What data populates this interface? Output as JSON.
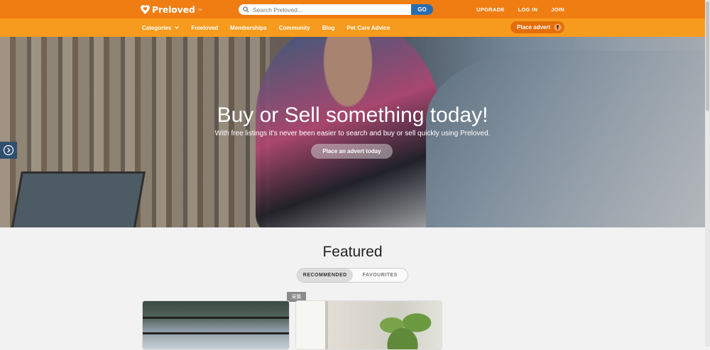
{
  "header": {
    "logo_text": "Preloved",
    "logo_tm": "TM",
    "search_placeholder": "Search Preloved...",
    "go_label": "GO",
    "links": [
      "UPGRADE",
      "LOG IN",
      "JOIN"
    ]
  },
  "nav": {
    "items": [
      "Categories",
      "Freeloved",
      "Memberships",
      "Community",
      "Blog",
      "Pet Care Advice"
    ],
    "place_advert": "Place advert"
  },
  "hero": {
    "title": "Buy or Sell something today!",
    "subtitle": "With free listings it's never been easier to search and buy or sell quickly using Preloved.",
    "cta": "Place an advert today"
  },
  "featured": {
    "title": "Featured",
    "tabs": [
      "RECOMMENDED",
      "FAVOURITES"
    ],
    "active_tab": "RECOMMENDED",
    "badge": "采集"
  },
  "colors": {
    "topbar": "#ef7d12",
    "navbar": "#f79b1e",
    "go_button": "#2b6cb0",
    "place_advert": "#e36e0b"
  }
}
